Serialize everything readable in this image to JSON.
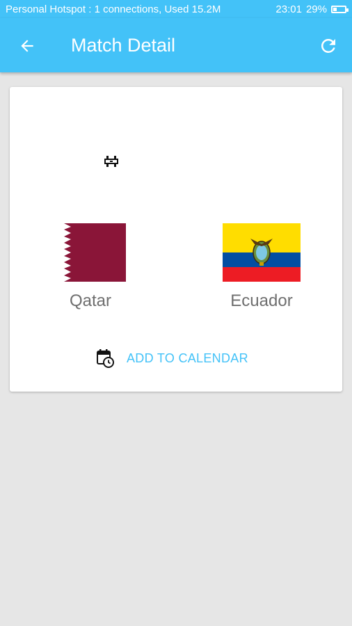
{
  "statusbar": {
    "left_text": "Personal Hotspot : 1 connections, Used 15.2M",
    "time": "23:01",
    "battery": "29%",
    "battery_level": 0.29
  },
  "appbar": {
    "title": "Match Detail",
    "back_icon": "arrow-left-icon",
    "refresh_icon": "refresh-icon",
    "color": "#43c2f8"
  },
  "match": {
    "vs_icon": "stadium-icon",
    "home_team": {
      "name": "Qatar",
      "flag_icon": "qatar-flag"
    },
    "away_team": {
      "name": "Ecuador",
      "flag_icon": "ecuador-flag"
    }
  },
  "calendar": {
    "label": "ADD TO CALENDAR",
    "icon": "calendar-clock-icon",
    "color": "#43c2f8"
  }
}
